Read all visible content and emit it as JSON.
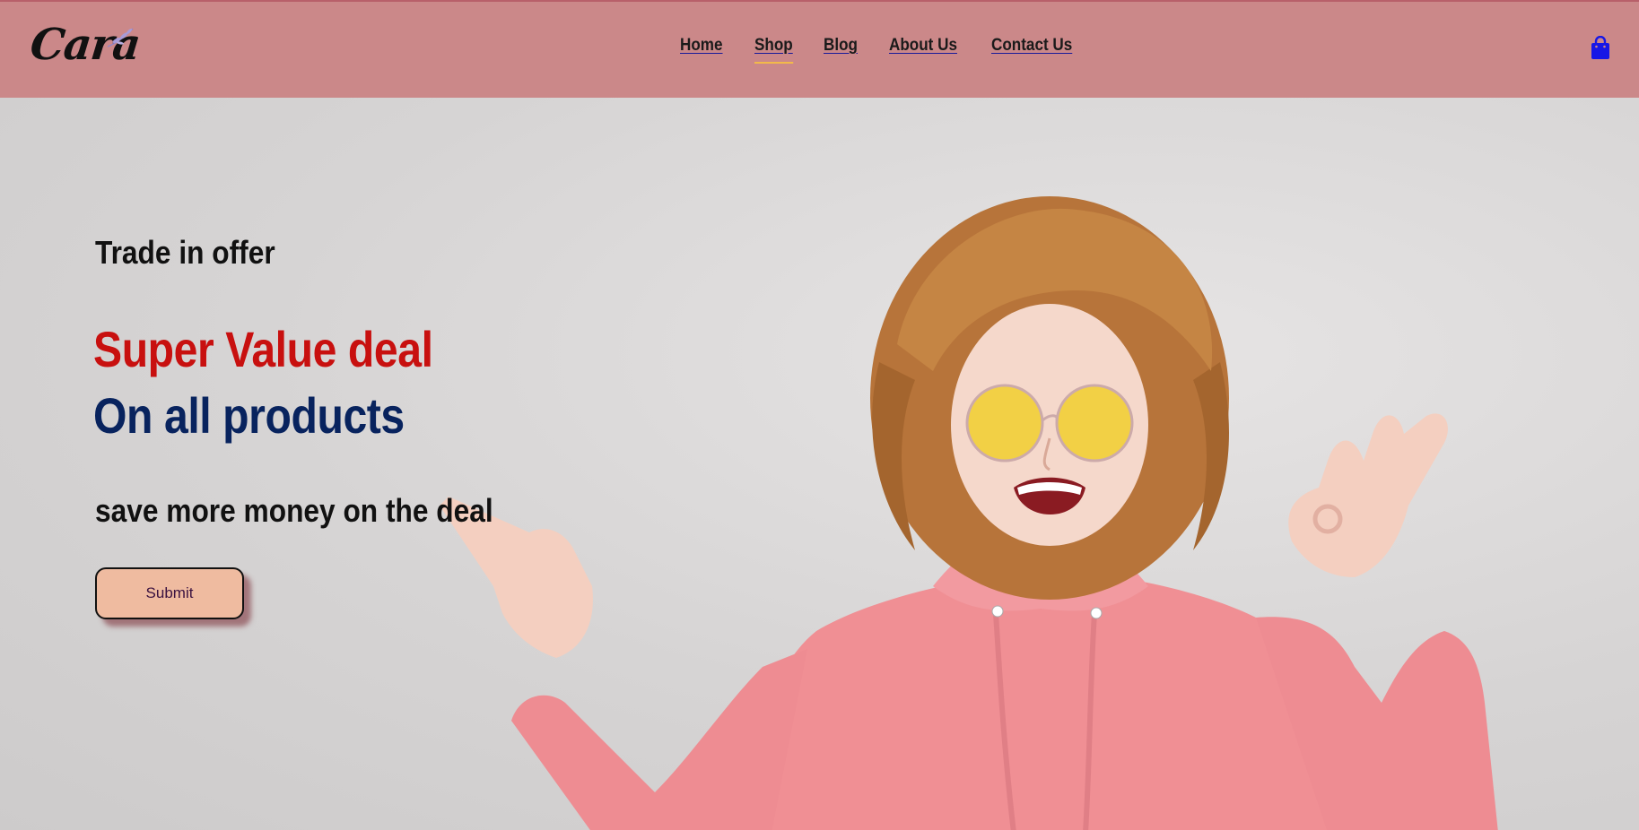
{
  "header": {
    "logo_text": "Cara",
    "nav": [
      {
        "label": "Home",
        "active": false
      },
      {
        "label": "Shop",
        "active": true
      },
      {
        "label": "Blog",
        "active": false
      },
      {
        "label": "About Us",
        "active": false
      },
      {
        "label": "Contact Us",
        "active": false
      }
    ],
    "cart_icon": "shopping-bag-icon"
  },
  "hero": {
    "tagline": "Trade in offer",
    "headline_1": "Super Value deal",
    "headline_2": "On all products",
    "subtext": "save more money on the deal",
    "button_label": "Submit"
  },
  "colors": {
    "header_bg": "#cb8889",
    "headline_1": "#c8100f",
    "headline_2": "#08235e",
    "button_bg": "#efbba0",
    "active_underline": "#f2b94a",
    "cart_icon": "#1717e6"
  }
}
